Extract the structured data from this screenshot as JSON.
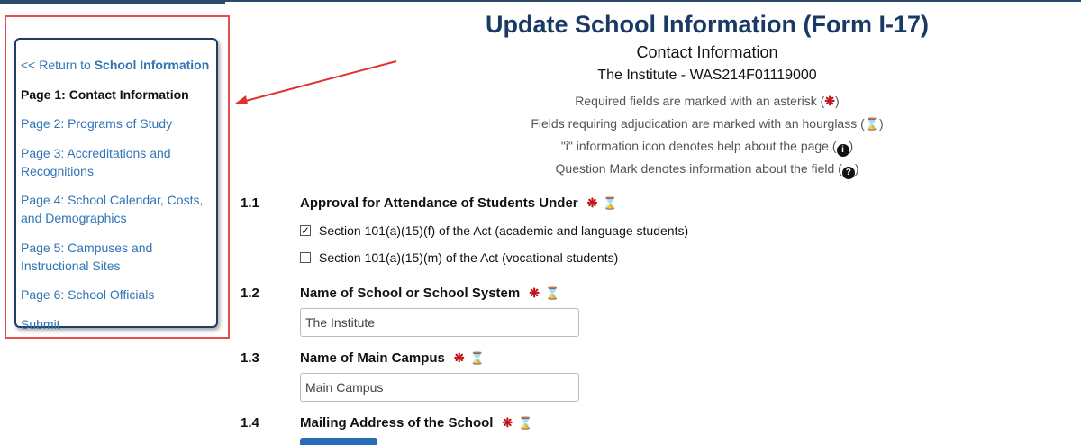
{
  "sidebar": {
    "return_prefix": "<< Return to ",
    "return_link": "School Information",
    "items": [
      {
        "label": "Page 1: Contact Information"
      },
      {
        "label": "Page 2: Programs of Study"
      },
      {
        "label": "Page 3: Accreditations and Recognitions"
      },
      {
        "label": "Page 4: School Calendar, Costs, and Demographics"
      },
      {
        "label": "Page 5: Campuses and Instructional Sites"
      },
      {
        "label": "Page 6: School Officials"
      },
      {
        "label": "Submit"
      }
    ]
  },
  "header": {
    "title": "Update School Information (Form I-17)",
    "subtitle": "Contact Information",
    "school": "The Institute - WAS214F01119000",
    "legend_required": "Required fields are marked with an asterisk (",
    "legend_adjudication": "Fields requiring adjudication are marked with an hourglass (",
    "legend_info": "\"i\" information icon denotes help about the page (",
    "legend_question": "Question Mark denotes information about the field (",
    "close_paren": ")"
  },
  "icons": {
    "asterisk": "❋",
    "hourglass": "⌛",
    "info": "i",
    "question": "?"
  },
  "form": {
    "q1": {
      "num": "1.1",
      "label": "Approval for Attendance of Students Under"
    },
    "q1_options": [
      {
        "label": "Section 101(a)(15)(f) of the Act (academic and language students)",
        "checked": true
      },
      {
        "label": "Section 101(a)(15)(m) of the Act (vocational students)",
        "checked": false
      }
    ],
    "q2": {
      "num": "1.2",
      "label": "Name of School or School System",
      "value": "The Institute"
    },
    "q3": {
      "num": "1.3",
      "label": "Name of Main Campus",
      "value": "Main Campus"
    },
    "q4": {
      "num": "1.4",
      "label": "Mailing Address of the School"
    }
  },
  "colors": {
    "title": "#1a3a66",
    "link": "#2f75b5",
    "required": "#c0141a",
    "highlight": "#e25050"
  }
}
